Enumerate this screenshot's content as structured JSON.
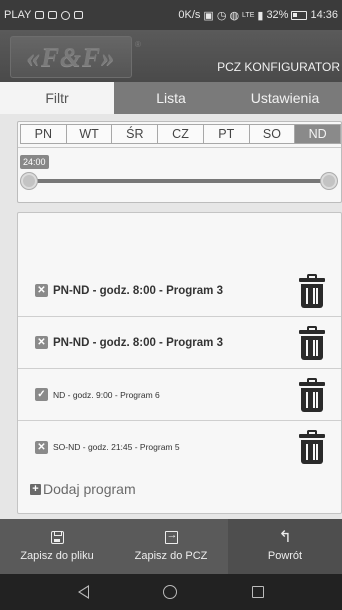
{
  "status_bar": {
    "carrier": "PLAY",
    "speed": "0K/s",
    "network": "LTE",
    "battery": "32%",
    "time": "14:36"
  },
  "header": {
    "logo_text": "«F&F»",
    "logo_mark": "®",
    "app_title": "PCZ KONFIGURATOR"
  },
  "tabs": [
    {
      "label": "Filtr",
      "active": true
    },
    {
      "label": "Lista",
      "active": false
    },
    {
      "label": "Ustawienia",
      "active": false
    }
  ],
  "days": [
    {
      "label": "PN",
      "active": false
    },
    {
      "label": "WT",
      "active": false
    },
    {
      "label": "ŚR",
      "active": false
    },
    {
      "label": "CZ",
      "active": false
    },
    {
      "label": "PT",
      "active": false
    },
    {
      "label": "SO",
      "active": false
    },
    {
      "label": "ND",
      "active": true
    }
  ],
  "time_slider": {
    "badge": "24:00"
  },
  "programs": [
    {
      "label": "PN-ND - godz. 8:00 - Program 3",
      "checked": false
    },
    {
      "label": "PN-ND - godz. 8:00 - Program 3",
      "checked": false
    },
    {
      "label": "ND - godz. 9:00 - Program 6",
      "checked": true
    },
    {
      "label": "SO-ND - godz. 21:45 - Program 5",
      "checked": false
    }
  ],
  "add_program_label": "Dodaj program",
  "toolbar": {
    "save_file": "Zapisz do pliku",
    "save_pcz": "Zapisz do PCZ",
    "back": "Powrót"
  },
  "icons": {
    "checkbox_checked": "✓",
    "checkbox_unchecked": "✕",
    "back_arrow": "↰"
  }
}
